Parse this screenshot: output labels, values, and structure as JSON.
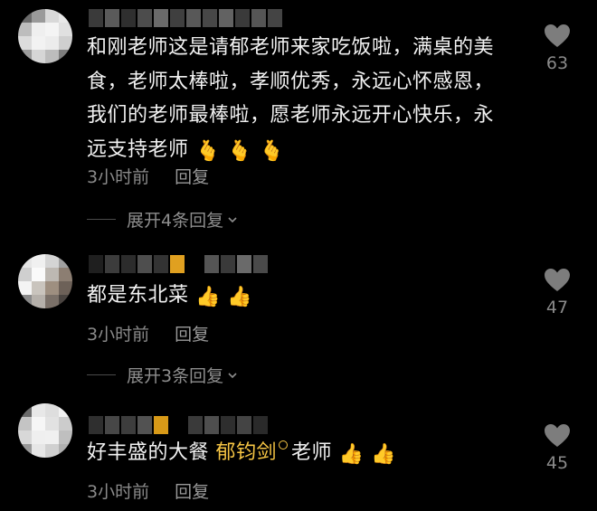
{
  "comments": [
    {
      "text_parts": [
        "和刚老师这是请郁老师来家吃饭啦，满桌的美",
        "食，老师太棒啦，孝顺优秀，永远心怀感恩，",
        "我们的老师最棒啦，愿老师永远开心快乐，永",
        "远支持老师"
      ],
      "emojis": [
        "🫰",
        "🫰",
        "🫰"
      ],
      "time": "3小时前",
      "reply_label": "回复",
      "like_count": "63",
      "expand_label": "展开4条回复"
    },
    {
      "text_parts": [
        "都是东北菜"
      ],
      "emojis": [
        "👍",
        "👍"
      ],
      "time": "3小时前",
      "reply_label": "回复",
      "like_count": "47",
      "expand_label": "展开3条回复"
    },
    {
      "text_before": "好丰盛的大餐",
      "mention": "郁钧剑",
      "text_after": "老师",
      "emojis": [
        "👍",
        "👍"
      ],
      "time": "3小时前",
      "reply_label": "回复",
      "like_count": "45"
    }
  ],
  "colors": {
    "background": "#000000",
    "text": "#f2f2f2",
    "muted": "#8a8a8a",
    "mention": "#f6c544"
  },
  "icons": {
    "like": "heart-icon",
    "expand": "chevron-down-icon"
  }
}
